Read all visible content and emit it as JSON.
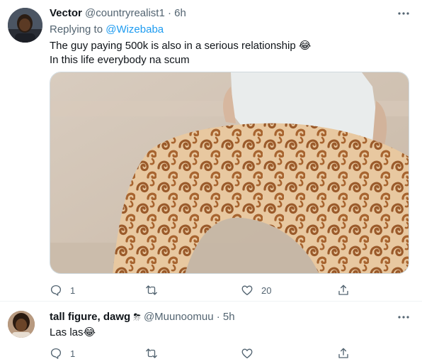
{
  "tweets": [
    {
      "author_name": "Vector",
      "author_handle": "@countryrealist1",
      "sep": "·",
      "time": "6h",
      "replying_prefix": "Replying to ",
      "replying_to": "@Wizebaba",
      "lines": [
        "The guy paying 500k is also in a serious relationship 😂",
        "In this life everybody na scum"
      ],
      "has_media": true,
      "counts": {
        "reply": "1",
        "retweet": "",
        "like": "20"
      }
    },
    {
      "author_name": "tall figure, dawg",
      "author_badge": "⛈",
      "author_handle": "@Muunoomuu",
      "sep": "·",
      "time": "5h",
      "lines": [
        "Las las😂"
      ],
      "has_media": false,
      "counts": {
        "reply": "1",
        "retweet": "",
        "like": ""
      }
    }
  ],
  "icons": {
    "more": "more-horizontal-icon",
    "reply": "reply-bubble-icon",
    "retweet": "retweet-icon",
    "like": "heart-icon",
    "share": "share-icon"
  },
  "colors": {
    "text": "#0f1419",
    "secondary": "#536471",
    "link": "#1d9bf0",
    "border": "#eff3f4"
  }
}
